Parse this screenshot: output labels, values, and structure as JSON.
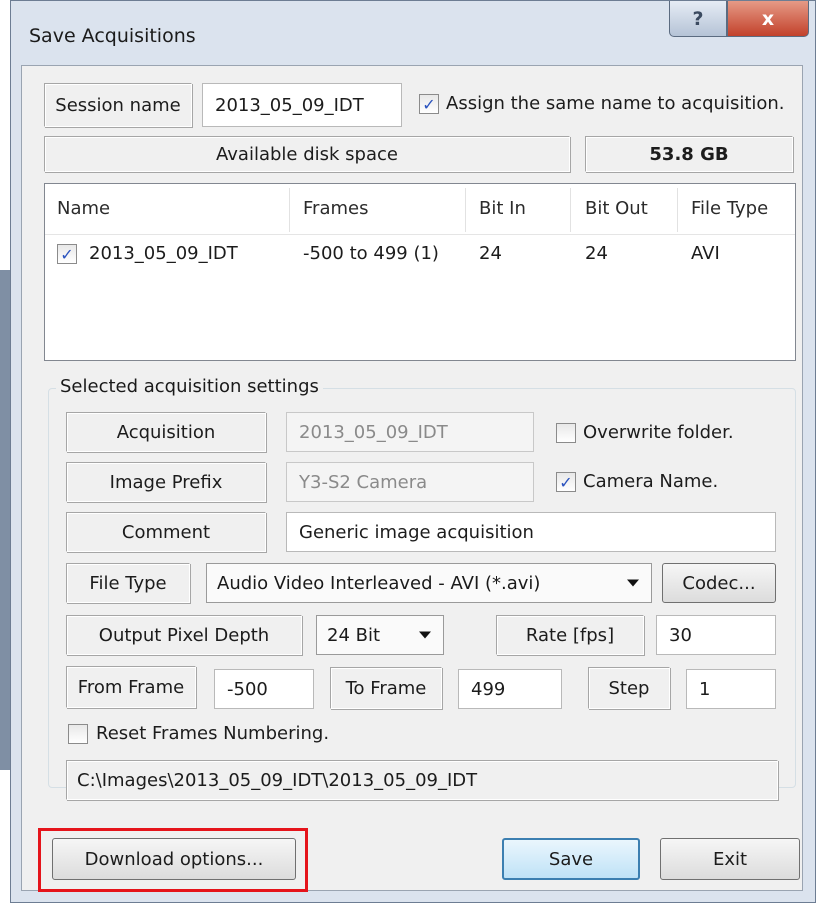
{
  "window": {
    "title": "Save Acquisitions",
    "help_glyph": "?",
    "close_glyph": "x"
  },
  "session": {
    "label": "Session name",
    "value": "2013_05_09_IDT",
    "assign_checked": true,
    "assign_label": "Assign the same name to acquisition."
  },
  "disk": {
    "label": "Available disk space",
    "value": "53.8 GB"
  },
  "acquisitions": {
    "columns": [
      "Name",
      "Frames",
      "Bit In",
      "Bit Out",
      "File Type"
    ],
    "rows": [
      {
        "checked": true,
        "name": "2013_05_09_IDT",
        "frames": "-500 to 499 (1)",
        "bit_in": "24",
        "bit_out": "24",
        "file_type": "AVI"
      }
    ]
  },
  "settings": {
    "group_title": "Selected acquisition settings",
    "acquisition_label": "Acquisition",
    "acquisition_value": "2013_05_09_IDT",
    "overwrite_checked": false,
    "overwrite_label": "Overwrite folder.",
    "prefix_label": "Image Prefix",
    "prefix_value": "Y3-S2 Camera",
    "camera_name_checked": true,
    "camera_name_label": "Camera Name.",
    "comment_label": "Comment",
    "comment_value": "Generic image acquisition",
    "file_type_label": "File Type",
    "file_type_value": "Audio Video Interleaved - AVI (*.avi)",
    "codec_button": "Codec...",
    "pixel_depth_label": "Output Pixel Depth",
    "pixel_depth_value": "24 Bit",
    "rate_label": "Rate [fps]",
    "rate_value": "30",
    "from_label": "From Frame",
    "from_value": "-500",
    "to_label": "To Frame",
    "to_value": "499",
    "step_label": "Step",
    "step_value": "1",
    "reset_checked": false,
    "reset_label": "Reset Frames Numbering.",
    "path": "C:\\Images\\2013_05_09_IDT\\2013_05_09_IDT"
  },
  "buttons": {
    "download": "Download options...",
    "save": "Save",
    "exit": "Exit"
  },
  "colors": {
    "highlight": "#e5141b",
    "check_mark": "#2a52be"
  }
}
